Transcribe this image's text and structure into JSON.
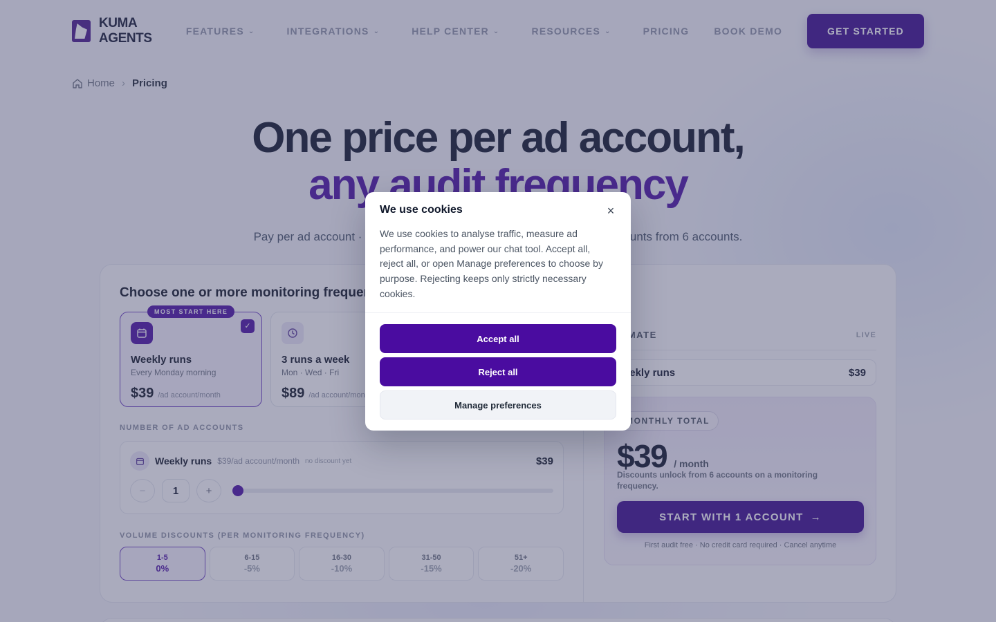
{
  "nav": {
    "logo": "KUMA AGENTS",
    "items": [
      {
        "label": "FEATURES",
        "has_menu": true
      },
      {
        "label": "INTEGRATIONS",
        "has_menu": true
      },
      {
        "label": "HELP CENTER",
        "has_menu": true
      },
      {
        "label": "RESOURCES",
        "has_menu": true
      },
      {
        "label": "PRICING",
        "has_menu": false
      },
      {
        "label": "BOOK DEMO",
        "has_menu": false
      }
    ],
    "cta": "GET STARTED"
  },
  "breadcrumb": {
    "home": "Home",
    "current": "Pricing"
  },
  "hero": {
    "line1": "One price per ad account,",
    "line2": "any audit frequency",
    "sub": "Pay per ad account · choose one or more monitoring frequencies · discounts from 6 accounts."
  },
  "plan": {
    "title": "Choose one or more monitoring frequencies",
    "frequencies": [
      {
        "name": "Weekly runs",
        "when": "Every Monday morning",
        "price": "$39",
        "unit": "/ad account/month",
        "badge": "MOST START HERE",
        "selected": true,
        "icon": "calendar-icon"
      },
      {
        "name": "3 runs a week",
        "when": "Mon · Wed · Fri",
        "price": "$89",
        "unit": "/ad account/month",
        "selected": false,
        "icon": "clock-icon"
      }
    ],
    "accounts_label": "NUMBER OF AD ACCOUNTS",
    "account_row": {
      "name": "Weekly runs",
      "rate": "$39/ad account/month",
      "note": "no discount yet",
      "amount": "$39",
      "count": "1",
      "minus": "−",
      "plus": "+"
    },
    "tiers_label": "VOLUME DISCOUNTS (PER MONITORING FREQUENCY)",
    "tiers": [
      {
        "range": "1-5",
        "discount": "0%",
        "selected": true
      },
      {
        "range": "6-15",
        "discount": "-5%",
        "selected": false
      },
      {
        "range": "16-30",
        "discount": "-10%",
        "selected": false
      },
      {
        "range": "31-50",
        "discount": "-15%",
        "selected": false
      },
      {
        "range": "51+",
        "discount": "-20%",
        "selected": false
      }
    ]
  },
  "estimate": {
    "label": "ESTIMATE",
    "live": "LIVE",
    "line": {
      "name": "Weekly runs",
      "value": "$39"
    },
    "total_label": "MONTHLY TOTAL",
    "total": "$39",
    "per": "/ month",
    "note": "Discounts unlock from 6 accounts on a monitoring frequency.",
    "button": "START WITH 1 ACCOUNT",
    "fine": "First audit free · No credit card required · Cancel anytime"
  },
  "cookie": {
    "title": "We use cookies",
    "body": "We use cookies to analyse traffic, measure ad performance, and power our chat tool. Accept all, reject all, or open Manage preferences to choose by purpose. Rejecting keeps only strictly necessary cookies.",
    "accept": "Accept all",
    "reject": "Reject all",
    "manage": "Manage preferences",
    "close": "×"
  },
  "colors": {
    "brand": "#4a0ca0",
    "overlay": "rgba(70,74,110,0.45)"
  }
}
